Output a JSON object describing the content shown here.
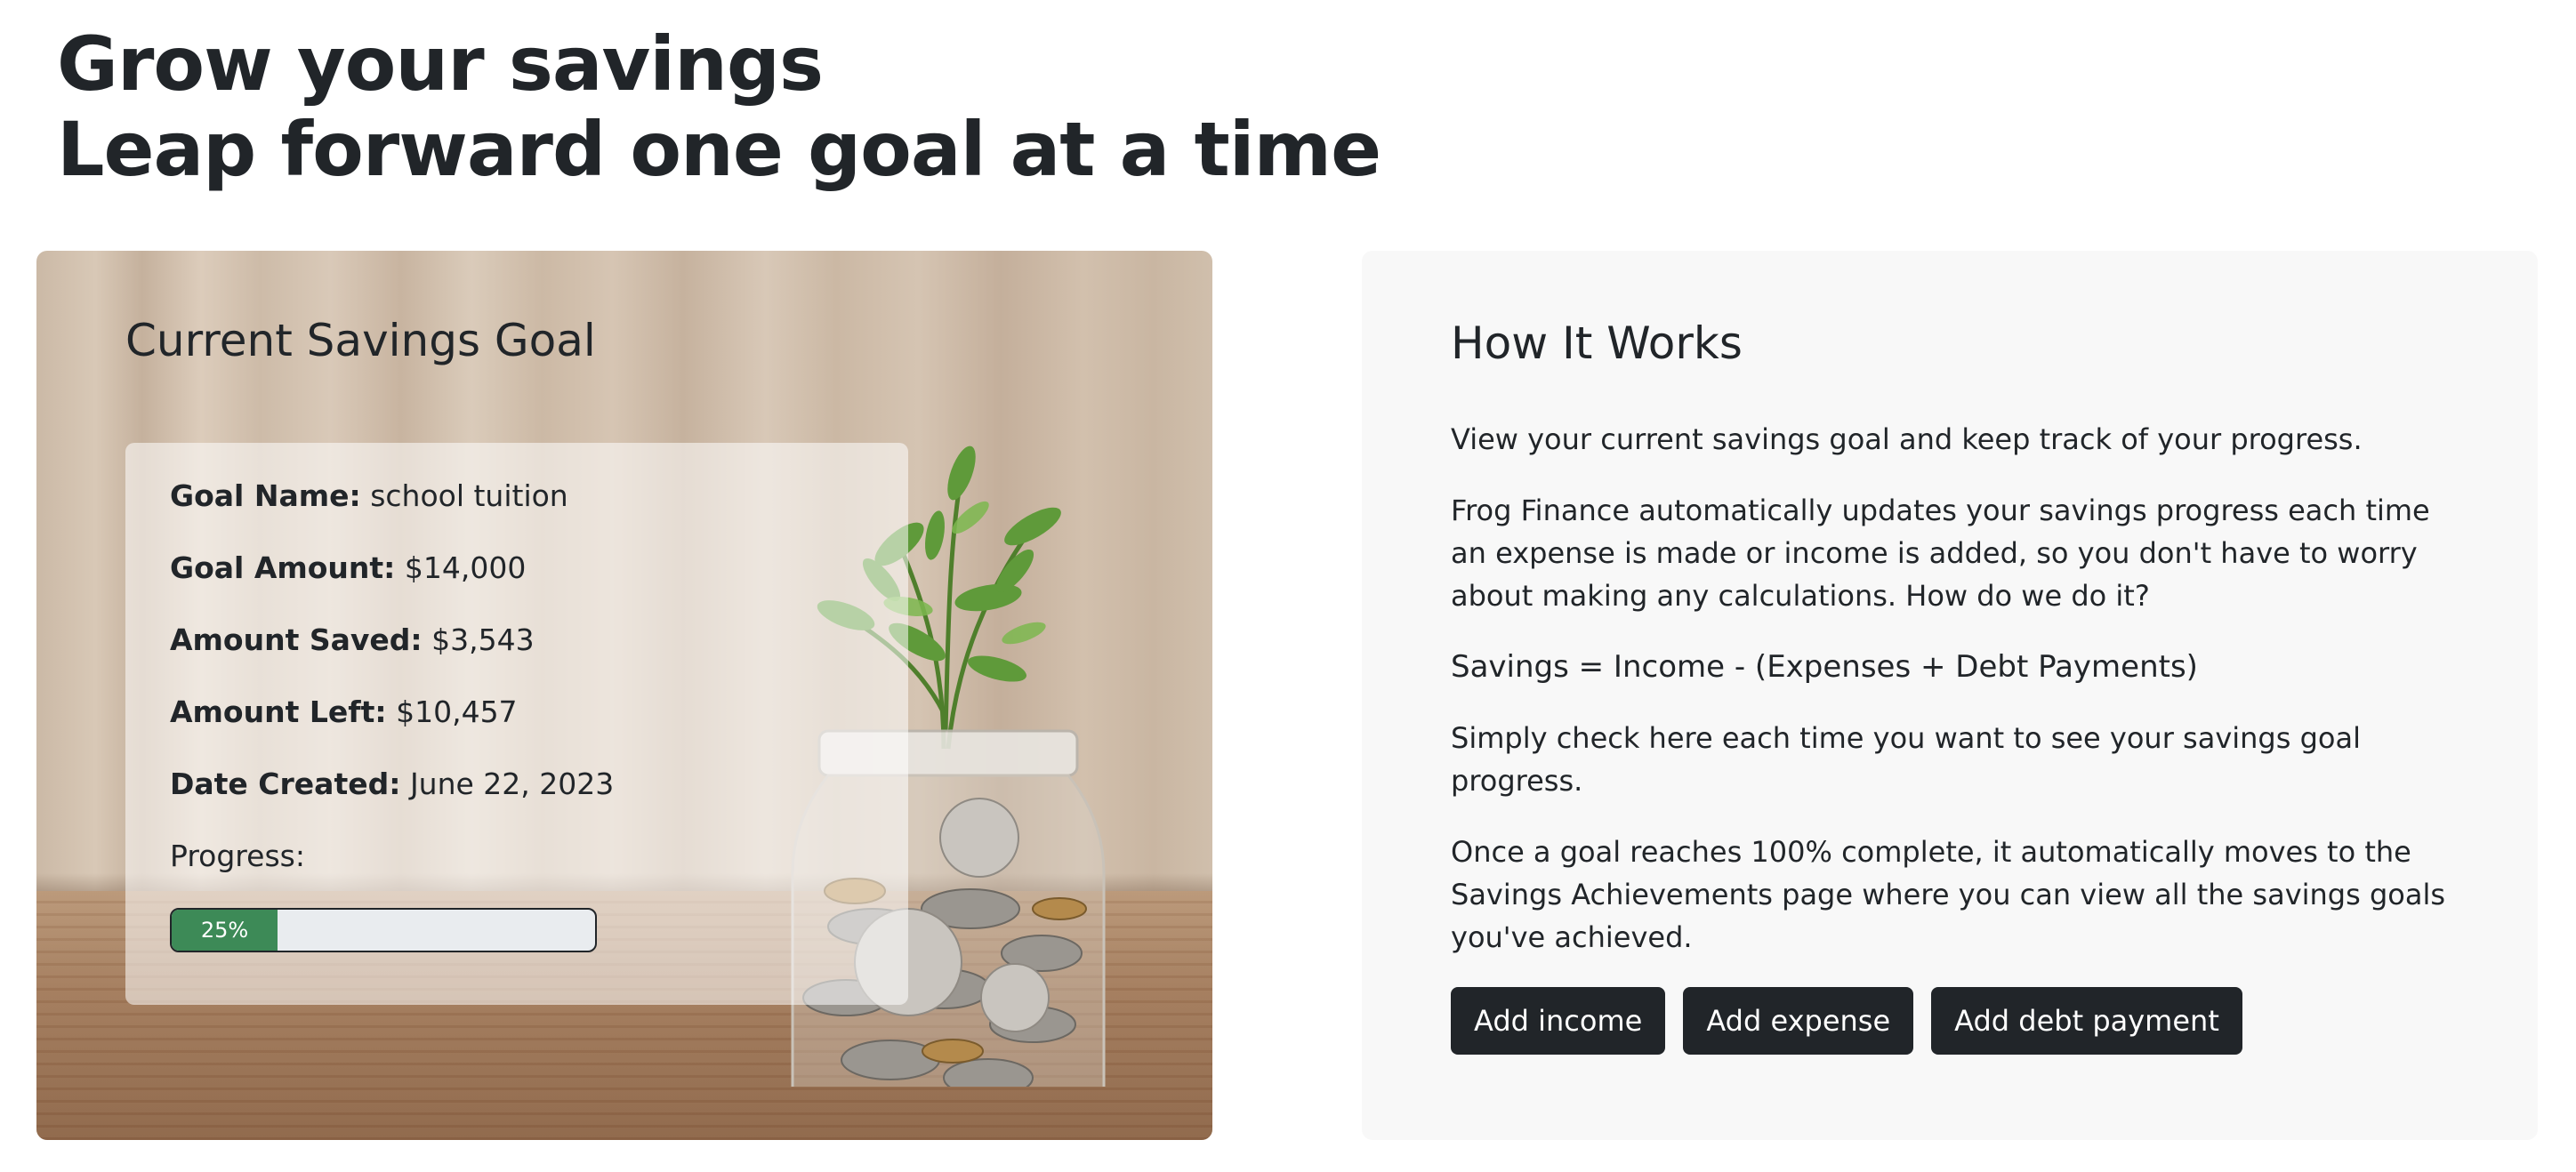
{
  "hero": {
    "line1": "Grow your savings",
    "line2": "Leap forward one goal at a time"
  },
  "goal": {
    "title": "Current Savings Goal",
    "name_label": "Goal Name:",
    "name_value": "school tuition",
    "amount_label": "Goal Amount:",
    "amount_value": "$14,000",
    "saved_label": "Amount Saved:",
    "saved_value": "$3,543",
    "left_label": "Amount Left:",
    "left_value": "$10,457",
    "date_label": "Date Created:",
    "date_value": "June 22, 2023",
    "progress_label": "Progress:",
    "progress_text": "25%",
    "progress_percent": 25,
    "progress_color": "#3d8a57"
  },
  "info": {
    "title": "How It Works",
    "p1": "View your current savings goal and keep track of your progress.",
    "p2": "Frog Finance automatically updates your savings progress each time an expense is made or income is added, so you don't have to worry about making any calculations. How do we do it?",
    "formula": "Savings = Income - (Expenses + Debt Payments)",
    "p3": "Simply check here each time you want to see your savings goal progress.",
    "p4": "Once a goal reaches 100% complete, it automatically moves to the Savings Achievements page where you can view all the savings goals you've achieved."
  },
  "actions": {
    "add_income": "Add income",
    "add_expense": "Add expense",
    "add_debt": "Add debt payment"
  },
  "colors": {
    "text": "#212529",
    "button_bg": "#212529",
    "info_bg": "#f8f8f8"
  }
}
